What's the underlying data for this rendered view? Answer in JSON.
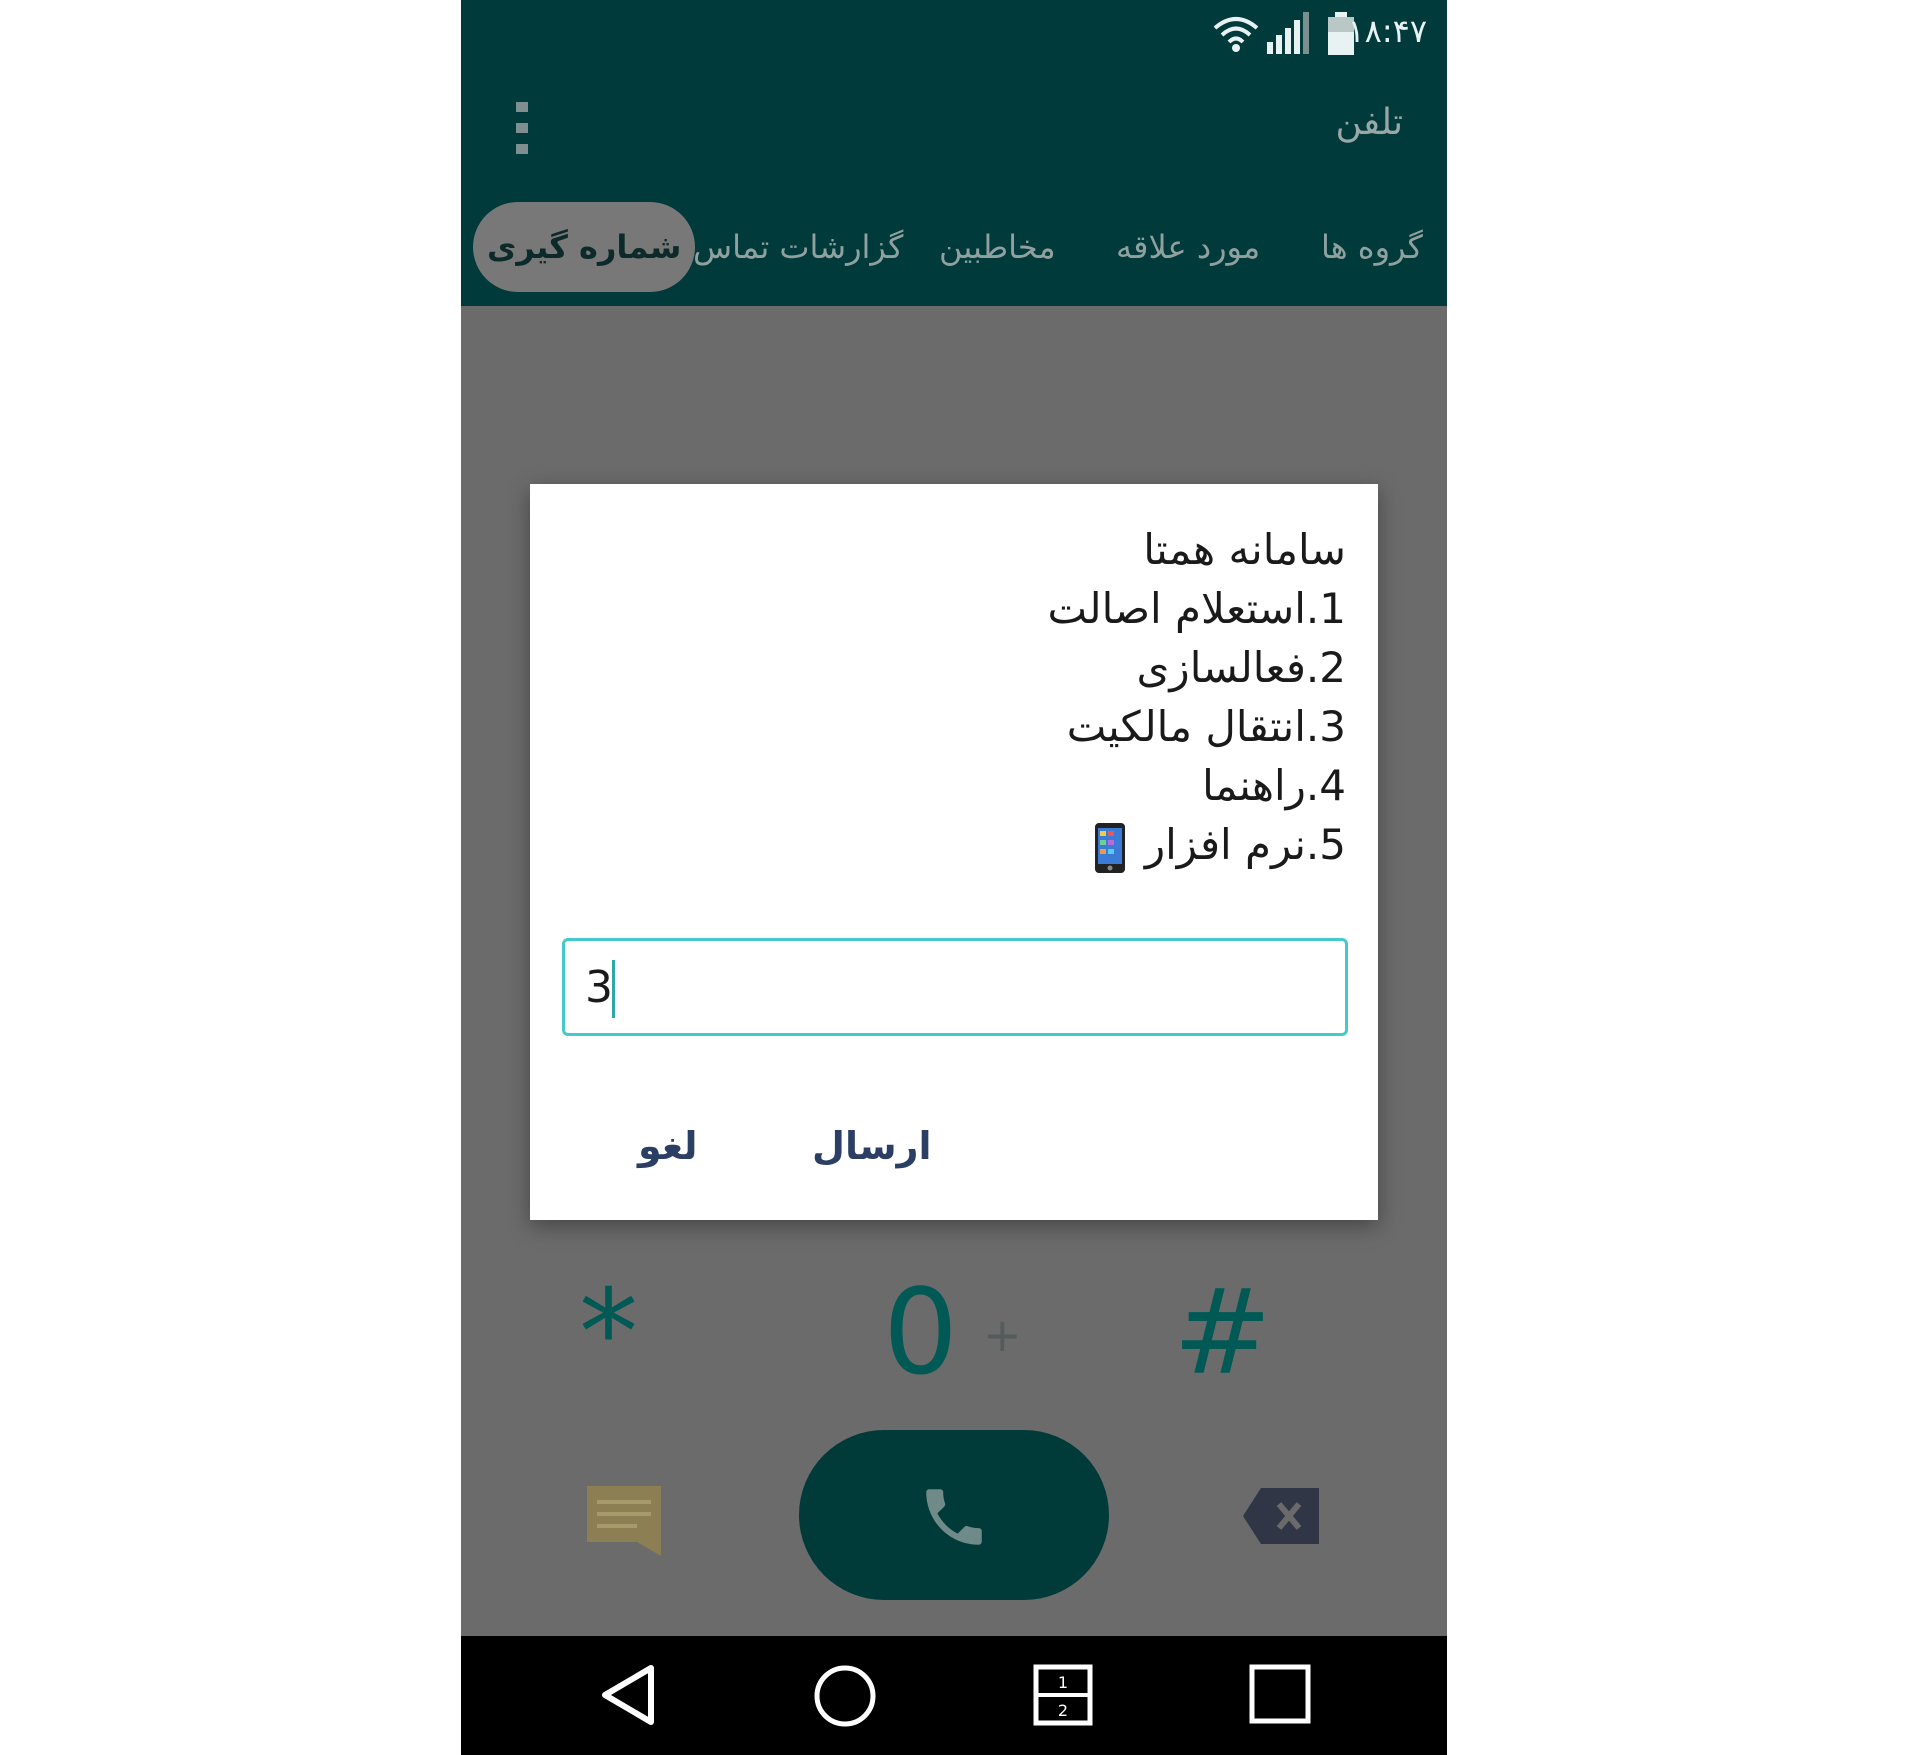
{
  "status_bar": {
    "time": "۱۸:۴۷",
    "icons": [
      "wifi-icon",
      "signal-icon",
      "battery-icon"
    ]
  },
  "app_bar": {
    "title": "تلفن",
    "menu_icon": "more-vertical-icon"
  },
  "tabs": [
    {
      "label": "گروه ها",
      "active": false
    },
    {
      "label": "مورد علاقه",
      "active": false
    },
    {
      "label": "مخاطبین",
      "active": false
    },
    {
      "label": "گزارشات تماس",
      "active": false
    },
    {
      "label": "شماره گیری",
      "active": true
    }
  ],
  "dialog": {
    "lines": [
      "سامانه همتا",
      "1.استعلام اصالت",
      "2.فعالسازی",
      "3.انتقال مالکیت",
      "4.راهنما",
      "5.نرم افزار"
    ],
    "input_value": "3",
    "send_label": "ارسال",
    "cancel_label": "لغو"
  },
  "keypad": {
    "star": "*",
    "zero": "0",
    "plus": "+",
    "hash": "#"
  },
  "colors": {
    "header": "#013a3b",
    "accent": "#44c9cc",
    "call_button": "#003b39",
    "dim_overlay": "#6b6b6b"
  },
  "nav_bar": {
    "icons": [
      "back-icon",
      "home-icon",
      "dual-window-icon",
      "recents-icon"
    ]
  }
}
